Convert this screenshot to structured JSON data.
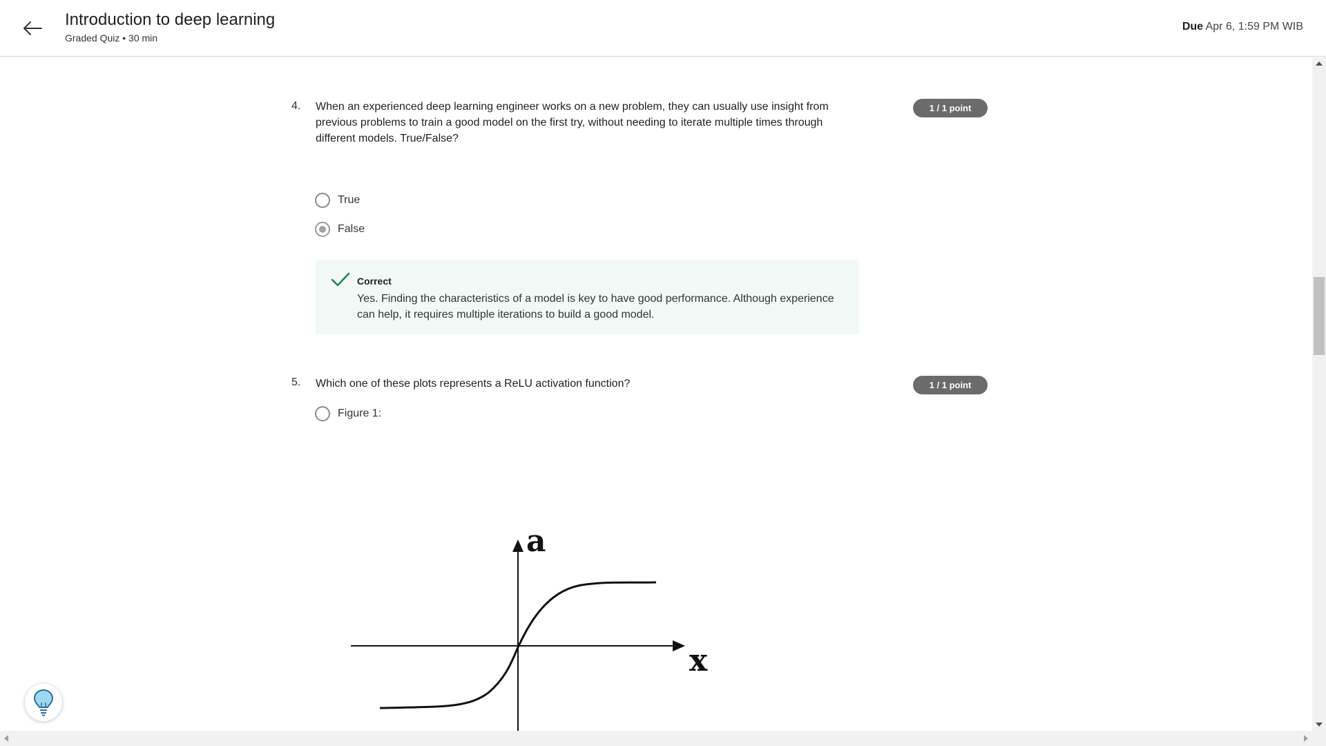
{
  "header": {
    "title": "Introduction to deep learning",
    "subtitle": "Graded Quiz • 30 min",
    "due_label": "Due",
    "due_value": "Apr 6, 1:59 PM WIB"
  },
  "questions": [
    {
      "number": "4.",
      "text": "When an experienced deep learning engineer works on a new problem, they can usually use insight from previous problems to train a good model on the first try, without needing to iterate multiple times through different models. True/False?",
      "points": "1 / 1 point",
      "options": [
        {
          "label": "True",
          "selected": false
        },
        {
          "label": "False",
          "selected": true
        }
      ],
      "feedback": {
        "status": "Correct",
        "text": "Yes. Finding the characteristics of a model is key to have good performance. Although experience can help, it requires multiple iterations to build a good model."
      }
    },
    {
      "number": "5.",
      "text": "Which one of these plots represents a ReLU activation function?",
      "points": "1 / 1 point",
      "options": [
        {
          "label": "Figure 1:",
          "selected": false
        }
      ],
      "figure": {
        "y_axis_label": "a",
        "x_axis_label": "x"
      }
    }
  ],
  "colors": {
    "accent_green": "#1f8354",
    "feedback_bg": "#f2f8f5",
    "badge_bg": "#6b6b6b"
  },
  "icons": {
    "back": "arrow-left-icon",
    "correct": "checkmark-icon",
    "hint": "lightbulb-icon"
  }
}
